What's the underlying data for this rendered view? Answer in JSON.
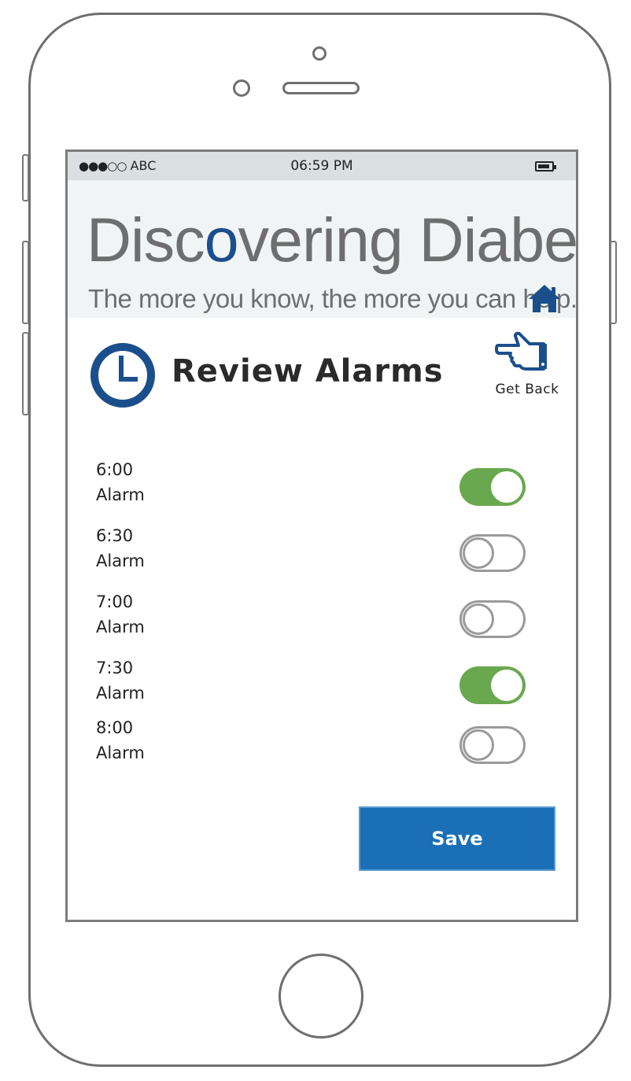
{
  "status_bar": {
    "carrier_dots": "●●●○○",
    "carrier": "ABC",
    "time": "06:59 PM",
    "battery_icon": "battery-icon"
  },
  "banner": {
    "title_start": "Disc",
    "title_o": "o",
    "title_end": "vering Diabetes",
    "tagline": "The more you know, the more you can help.",
    "home_icon": "home-icon"
  },
  "page": {
    "title": "Review Alarms",
    "clock_icon": "clock-icon"
  },
  "back": {
    "label": "Get Back",
    "icon": "pointing-hand-icon"
  },
  "alarms": [
    {
      "time": "6:00",
      "label": "Alarm",
      "enabled": true
    },
    {
      "time": "6:30",
      "label": "Alarm",
      "enabled": false
    },
    {
      "time": "7:00",
      "label": "Alarm",
      "enabled": false
    },
    {
      "time": "7:30",
      "label": "Alarm",
      "enabled": true
    },
    {
      "time": "8:00",
      "label": "Alarm",
      "enabled": false
    }
  ],
  "save_label": "Save",
  "colors": {
    "accent": "#1b6fb6",
    "toggle_on": "#6aa84f",
    "brand_blue": "#1a4f8c",
    "status_bar_bg": "#dadfe2",
    "banner_bg": "#f1f4f5"
  }
}
